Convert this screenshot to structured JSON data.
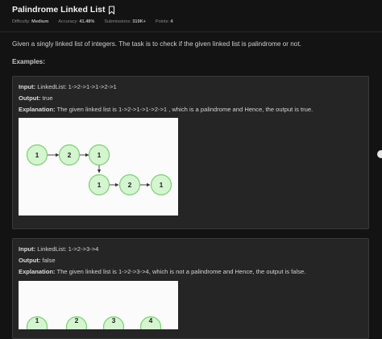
{
  "problem": {
    "title": "Palindrome Linked List",
    "meta": {
      "difficulty_label": "Difficulty:",
      "difficulty_value": "Medium",
      "accuracy_label": "Accuracy:",
      "accuracy_value": "41.48%",
      "submissions_label": "Submissions:",
      "submissions_value": "319K+",
      "points_label": "Points:",
      "points_value": "4"
    },
    "statement": "Given a singly linked list of integers. The task is to check if the given linked list is palindrome or not.",
    "examples_heading": "Examples:"
  },
  "examples": [
    {
      "input_label": "Input:",
      "input_value": " LinkedList: 1->2->1->1->2->1",
      "output_label": "Output:",
      "output_value": " true",
      "explanation_label": "Explanation:",
      "explanation_value": " The given linked list is 1->2->1->1->2->1 , which is a palindrome and Hence, the output is true.",
      "nodes": [
        "1",
        "2",
        "1",
        "1",
        "2",
        "1"
      ]
    },
    {
      "input_label": "Input:",
      "input_value": " LinkedList: 1->2->3->4",
      "output_label": "Output:",
      "output_value": " false",
      "explanation_label": "Explanation:",
      "explanation_value": " The given linked list is 1->2->3->4, which is not a palindrome and Hence, the output is false.",
      "nodes": [
        "1",
        "2",
        "3",
        "4"
      ]
    }
  ],
  "colors": {
    "background": "#131313",
    "card": "#252525",
    "node_fill": "#d4f5d0",
    "node_stroke": "#7ccf74"
  },
  "icons": {
    "bookmark": "bookmark-icon"
  }
}
